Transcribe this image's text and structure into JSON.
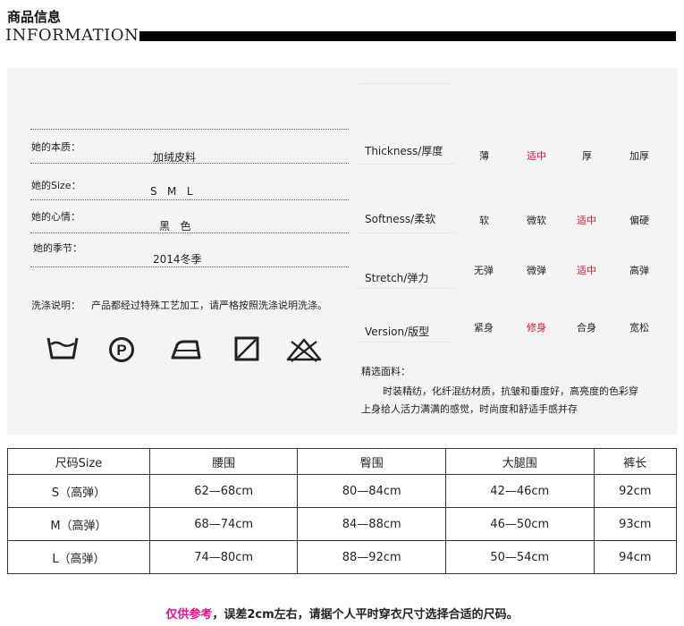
{
  "header": {
    "title_cn": "商品信息",
    "title_en": "INFORMATION"
  },
  "left": {
    "rows": [
      {
        "label": "她的本质：",
        "value": "加绒皮料"
      },
      {
        "label": "她的Size：",
        "value": "S   M   L"
      },
      {
        "label": "她的心情：",
        "value": "黑   色"
      },
      {
        "label": "她的季节：",
        "value": "2014冬季"
      }
    ],
    "wash_label": "洗涤说明：",
    "wash_text": "产品都经过特殊工艺加工，请严格按照洗涤说明洗涤。",
    "wash_icons": [
      "wash-basin-icon",
      "dry-clean-p-icon",
      "iron-icon",
      "tumble-dry-prohibited-icon",
      "do-not-wash-icon"
    ]
  },
  "right": {
    "attributes": [
      {
        "name": "Thickness/厚度",
        "options": [
          "薄",
          "适中",
          "厚",
          "加厚"
        ],
        "selected": 1
      },
      {
        "name": "Softness/柔软",
        "options": [
          "软",
          "微软",
          "适中",
          "偏硬"
        ],
        "selected": 2
      },
      {
        "name": "Stretch/弹力",
        "options": [
          "无弹",
          "微弹",
          "适中",
          "高弹"
        ],
        "selected": 2
      },
      {
        "name": "Version/版型",
        "options": [
          "紧身",
          "修身",
          "合身",
          "宽松"
        ],
        "selected": 1
      }
    ],
    "fabric_title": "精选面料：",
    "fabric_line1": "时装精纺，化纤混纺材质，抗皱和垂度好，高亮度的色彩穿",
    "fabric_line2": "上身给人活力满满的感觉，时尚度和舒适手感并存",
    "selected_color": "#e0102b"
  },
  "size_table": {
    "headers": [
      "尺码Size",
      "腰围",
      "臀围",
      "大腿围",
      "裤长"
    ],
    "rows": [
      [
        "S（高弹）",
        "62—68cm",
        "80—84cm",
        "42—46cm",
        "92cm"
      ],
      [
        "M（高弹）",
        "68—74cm",
        "84—88cm",
        "46—50cm",
        "93cm"
      ],
      [
        "L（高弹）",
        "74—80cm",
        "88—92cm",
        "50—54cm",
        "94cm"
      ]
    ]
  },
  "footer": {
    "highlight": "仅供参考",
    "rest": "，误差2cm左右，请据个人平时穿衣尺寸选择合适的尺码。",
    "highlight_color": "#e60e8c"
  }
}
